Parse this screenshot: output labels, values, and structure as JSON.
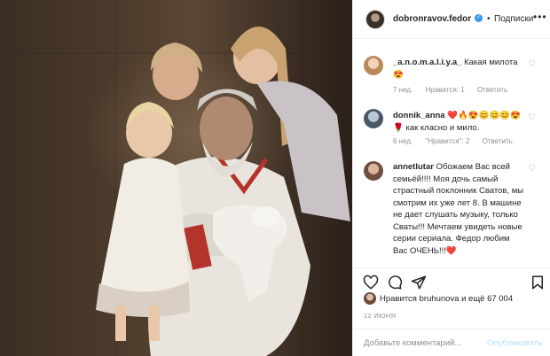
{
  "header": {
    "username": "dobronravov.fedor",
    "separator": "•",
    "follow_label": "Подписки",
    "more_label": "•••"
  },
  "comments": [
    {
      "username": "_a.n.o.m.a.l.i.y.a_",
      "text": "Какая милота 😍",
      "time": "7 нед.",
      "likes": "Нравится: 1",
      "reply": "Ответить"
    },
    {
      "username": "donnik_anna",
      "text": "❤️🔥😍😊😊😊😍🌹 как класно и мило.",
      "time": "6 нед.",
      "likes": "\"Нравится\": 2",
      "reply": "Ответить"
    },
    {
      "username": "annetlutar",
      "text": "Обожаем Вас всей семьёй!!!! Моя дочь самый страстный поклонник Сватов, мы смотрим их уже лет 8. В машине не дает слушать музыку, только Сваты!!! Мечтаем увидеть новые серии сериала. Федор любим Вас ОЧЕНЬ!!!❤️"
    }
  ],
  "likes": {
    "text": "Нравится bruhunova и ещё 67 004"
  },
  "date": "12 ИЮНЯ",
  "add_comment": {
    "placeholder": "Добавьте комментарий...",
    "publish_label": "Опубликовать"
  },
  "colors": {
    "accent": "#3897f0",
    "muted": "#8e8e8e",
    "publish_disabled": "#b2dffc"
  }
}
